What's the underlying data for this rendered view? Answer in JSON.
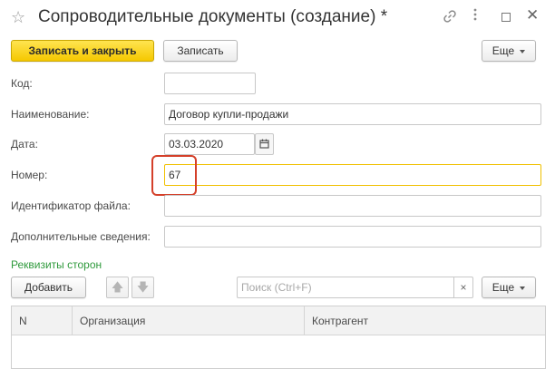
{
  "window": {
    "title": "Сопроводительные документы (создание) *",
    "favorite_icon": "star-icon",
    "link_icon": "link-icon",
    "more_icon": "more-vert-icon",
    "maximize_icon": "maximize-icon",
    "close_icon": "close-icon"
  },
  "toolbar": {
    "save_close_label": "Записать и закрыть",
    "save_label": "Записать",
    "more_label": "Еще"
  },
  "form": {
    "code": {
      "label": "Код:",
      "value": ""
    },
    "name": {
      "label": "Наименование:",
      "value": "Договор купли-продажи"
    },
    "date": {
      "label": "Дата:",
      "value": "03.03.2020"
    },
    "number": {
      "label": "Номер:",
      "value": "67"
    },
    "file_id": {
      "label": "Идентификатор файла:",
      "value": ""
    },
    "extra": {
      "label": "Дополнительные сведения:",
      "value": ""
    }
  },
  "section": {
    "title": "Реквизиты сторон",
    "add_label": "Добавить",
    "search_placeholder": "Поиск (Ctrl+F)",
    "clear_symbol": "×",
    "more_label": "Еще",
    "up_arrow": "🡅",
    "down_arrow": "🡇"
  },
  "table": {
    "columns": [
      "N",
      "Организация",
      "Контрагент"
    ],
    "rows": []
  },
  "colors": {
    "accent_yellow": "#f5c800",
    "focus_border": "#f0c000",
    "highlight_red": "#d4402a",
    "section_green": "#2f9a3c"
  }
}
